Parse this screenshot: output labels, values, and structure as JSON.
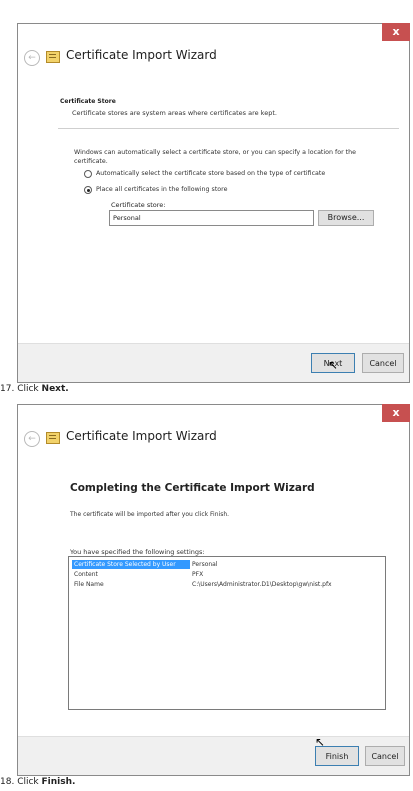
{
  "wizard1": {
    "close_label": "x",
    "title": "Certificate Import Wizard",
    "section_heading": "Certificate Store",
    "section_subtitle": "Certificate stores are system areas where certificates are kept.",
    "description": "Windows can automatically select a certificate store, or you can specify a location for the certificate.",
    "option_auto": "Automatically select the certificate store based on the type of certificate",
    "option_place": "Place all certificates in the following store",
    "store_label": "Certificate store:",
    "store_value": "Personal",
    "browse_label": "Browse...",
    "next_label": "Next",
    "cancel_label": "Cancel"
  },
  "step17": {
    "number": "17.",
    "prefix": "Click",
    "action": "Next."
  },
  "wizard2": {
    "close_label": "x",
    "title": "Certificate Import Wizard",
    "heading": "Completing the Certificate Import Wizard",
    "info": "The certificate will be imported after you click Finish.",
    "settings_label": "You have specified the following settings:",
    "settings": [
      {
        "key": "Certificate Store Selected by User",
        "value": "Personal"
      },
      {
        "key": "Content",
        "value": "PFX"
      },
      {
        "key": "File Name",
        "value": "C:\\Users\\Administrator.D1\\Desktop\\gw\\nist.pfx"
      }
    ],
    "finish_label": "Finish",
    "cancel_label": "Cancel"
  },
  "step18": {
    "number": "18.",
    "prefix": "Click",
    "action": "Finish."
  }
}
